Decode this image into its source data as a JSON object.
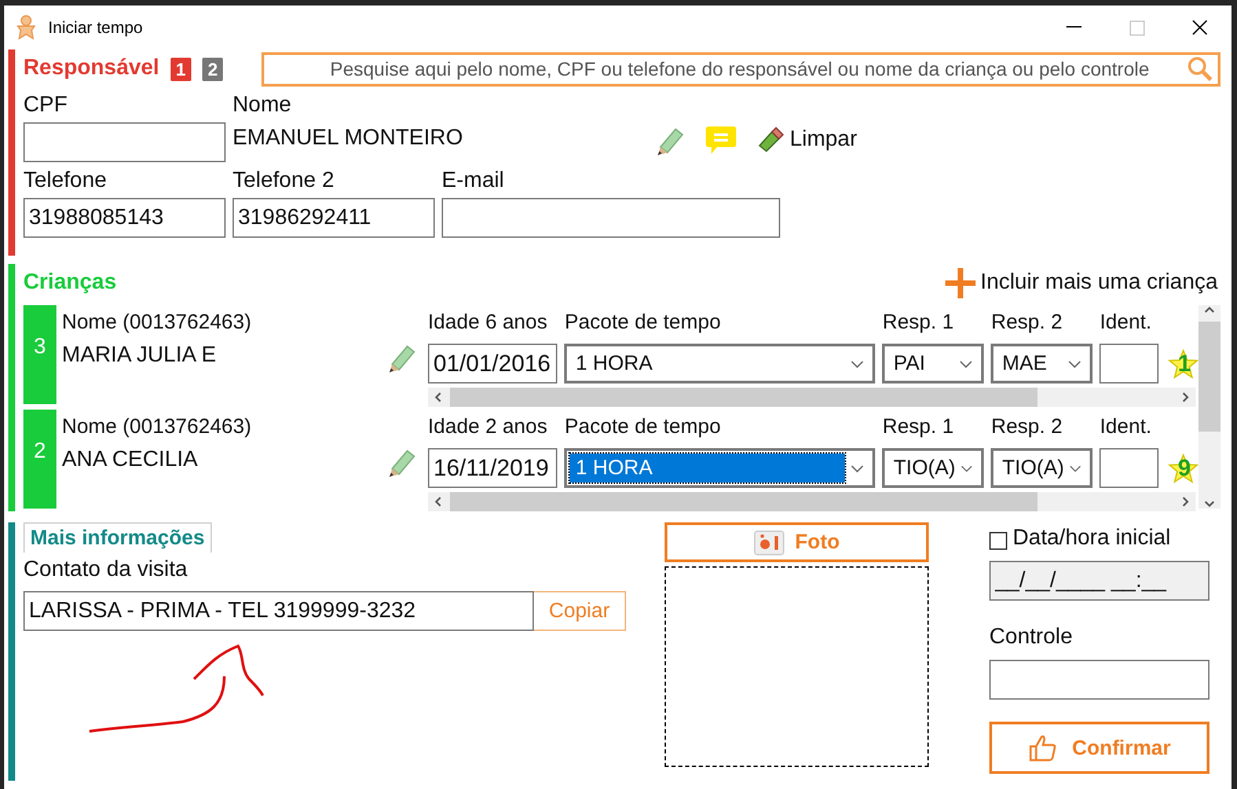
{
  "window": {
    "title": "Iniciar tempo"
  },
  "responsavel": {
    "title": "Responsável",
    "tabs": [
      {
        "label": "1",
        "selected": true
      },
      {
        "label": "2",
        "selected": false
      }
    ],
    "search": {
      "placeholder": "Pesquise aqui pelo nome, CPF ou telefone do responsável ou nome da criança ou pelo controle"
    },
    "cpf": {
      "label": "CPF"
    },
    "nome": {
      "label": "Nome",
      "value": "EMANUEL MONTEIRO"
    },
    "clear_button": "Limpar",
    "telefone": {
      "label": "Telefone",
      "value": "31988085143"
    },
    "telefone2": {
      "label": "Telefone 2",
      "value": "31986292411"
    },
    "email": {
      "label": "E-mail"
    }
  },
  "criancas": {
    "title": "Crianças",
    "add_button": "Incluir mais uma criança",
    "children": [
      {
        "number": "3",
        "name_label": "Nome (0013762463)",
        "name": "MARIA JULIA E",
        "age_label": "Idade 6 anos",
        "birth_date": "01/01/2016",
        "package_label": "Pacote de tempo",
        "package": "1 HORA",
        "package_highlighted": false,
        "resp1_label": "Resp. 1",
        "resp1": "PAI",
        "resp2_label": "Resp. 2",
        "resp2": "MAE",
        "ident_label": "Ident.",
        "star_number": "1"
      },
      {
        "number": "2",
        "name_label": "Nome (0013762463)",
        "name": "ANA CECILIA",
        "age_label": "Idade 2 anos",
        "birth_date": "16/11/2019",
        "package_label": "Pacote de tempo",
        "package": "1 HORA",
        "package_highlighted": true,
        "resp1_label": "Resp. 1",
        "resp1": "TIO(A)",
        "resp2_label": "Resp. 2",
        "resp2": "TIO(A)",
        "ident_label": "Ident.",
        "star_number": "9"
      }
    ]
  },
  "mais_informacoes": {
    "tab": "Mais informações",
    "contact_label": "Contato da visita",
    "contact": "LARISSA - PRIMA - TEL 3199999-3232",
    "copy_button": "Copiar"
  },
  "foto": {
    "button": "Foto"
  },
  "start": {
    "checkbox_label": "Data/hora inicial",
    "checked": false,
    "datetime": "__/__/____ __:__"
  },
  "controle": {
    "label": "Controle"
  },
  "confirm_button": "Confirmar"
}
